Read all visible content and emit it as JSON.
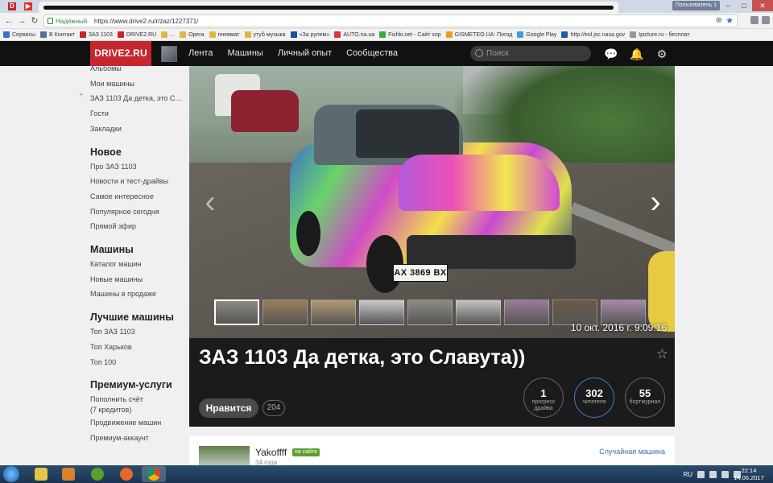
{
  "browser": {
    "user_badge": "Пользователь 1",
    "secure_label": "Надежный",
    "url": "https://www.drive2.ru/r/zaz/1227371/"
  },
  "bookmarks": [
    {
      "label": "Сервисы",
      "color": "#3b6fd6"
    },
    {
      "label": "В Контакт",
      "color": "#4c75a3"
    },
    {
      "label": "ЗАЗ 1103",
      "color": "#c6262e"
    },
    {
      "label": "DRIVE2.RU",
      "color": "#c6262e"
    },
    {
      "label": "...",
      "color": "#e0b64a"
    },
    {
      "label": "Opera",
      "color": "#e0b64a"
    },
    {
      "label": "пневмат",
      "color": "#e0b64a"
    },
    {
      "label": "утуб музыка",
      "color": "#e0b64a"
    },
    {
      "label": "«За рулем»",
      "color": "#1d4fa0"
    },
    {
      "label": "AUTO.ria.ua",
      "color": "#d93636"
    },
    {
      "label": "Fishki.net - Сайт хор",
      "color": "#3ea83a"
    },
    {
      "label": "GISMETEO.UA: Погод",
      "color": "#f29b1d"
    },
    {
      "label": "Google Play",
      "color": "#3aa3d6"
    },
    {
      "label": "http://eol.jsc.nasa.gov",
      "color": "#1c5fa8"
    },
    {
      "label": "Ipicture.ru - бесплат",
      "color": "#999999"
    }
  ],
  "site": {
    "logo": "DRIVE2.RU",
    "nav": [
      "Лента",
      "Машины",
      "Личный опыт",
      "Сообщества"
    ],
    "search_placeholder": "Поиск"
  },
  "sidebar": {
    "top_links": [
      "Альбомы",
      "Мои машины",
      "ЗАЗ 1103 Да детка, это Слав...",
      "Гости",
      "Закладки"
    ],
    "sections": [
      {
        "title": "Новое",
        "links": [
          "Про ЗАЗ 1103",
          "Новости и тест-драйвы",
          "Самое интересное",
          "Популярное сегодня",
          "Прямой эфир"
        ]
      },
      {
        "title": "Машины",
        "links": [
          "Каталог машин",
          "Новые машины",
          "Машины в продаже"
        ]
      },
      {
        "title": "Лучшие машины",
        "links": [
          "Топ ЗАЗ 1103",
          "Топ Харьков",
          "Топ 100"
        ]
      },
      {
        "title": "Премиум-услуги",
        "links": [
          "Пополнить счёт",
          "(7 кредитов)",
          "Продвижение машин",
          "Премиум-аккаунт"
        ]
      }
    ]
  },
  "photo": {
    "plate": "AX 3869 BX",
    "date": "10 окт. 2016 г. 9:09:16",
    "thumb_colors": [
      "#8e8a82",
      "#9a7e5a",
      "#b39a72",
      "#c9cbcd",
      "#8d8c87",
      "#c3c3c1",
      "#9c7c9a",
      "#6a5a4a",
      "#a98aa6"
    ]
  },
  "car": {
    "title": "ЗАЗ 1103 Да детка, это Славута))",
    "like_label": "Нравится",
    "like_count": "204",
    "stats": [
      {
        "num": "1",
        "label": "прогресс драйва"
      },
      {
        "num": "302",
        "label": "читателя"
      },
      {
        "num": "55",
        "label": "бортжурнал"
      }
    ]
  },
  "owner": {
    "name": "Yakoffff",
    "online_badge": "на сайте",
    "age": "34 года",
    "random_link": "Случайная машина"
  },
  "taskbar": {
    "lang": "RU",
    "time": "22:14",
    "date": "14.06.2017"
  }
}
